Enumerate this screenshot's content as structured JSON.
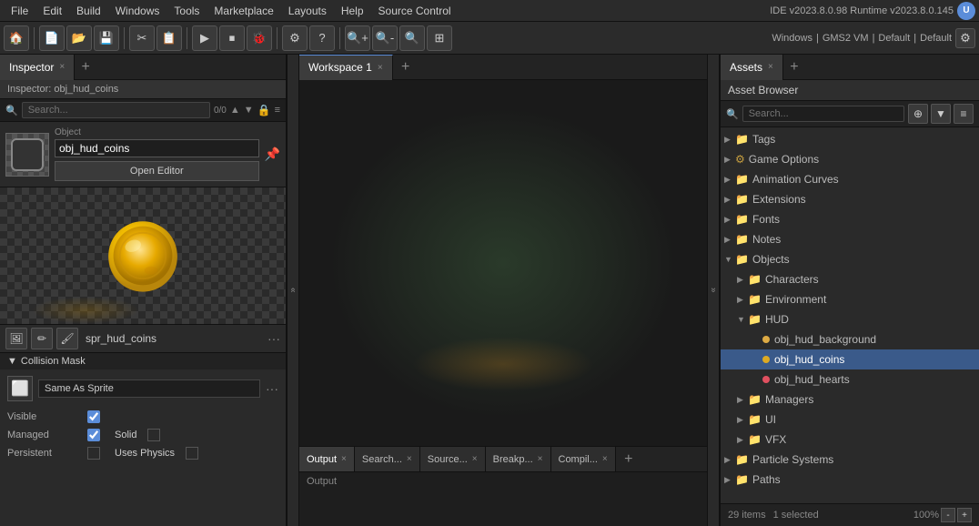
{
  "menubar": {
    "items": [
      "File",
      "Edit",
      "Build",
      "Windows",
      "Tools",
      "Marketplace",
      "Layouts",
      "Help",
      "Source Control"
    ],
    "version_info": "IDE v2023.8.0.98  Runtime v2023.8.0.145"
  },
  "toolbar": {
    "windows_label": "Windows",
    "gms2vm_label": "GMS2 VM",
    "default_labels": [
      "Default",
      "Default"
    ]
  },
  "inspector": {
    "tab_label": "Inspector",
    "header_text": "Inspector: obj_hud_coins",
    "search_placeholder": "Search...",
    "search_count": "0/0",
    "object_label": "Object",
    "object_name": "obj_hud_coins",
    "open_editor_label": "Open Editor"
  },
  "sprite": {
    "name": "spr_hud_coins"
  },
  "collision": {
    "section_label": "Collision Mask",
    "value": "Same As Sprite"
  },
  "properties": {
    "visible_label": "Visible",
    "managed_label": "Managed",
    "solid_label": "Solid",
    "persistent_label": "Persistent",
    "uses_physics_label": "Uses Physics"
  },
  "workspace": {
    "tab_label": "Workspace 1"
  },
  "output": {
    "tabs": [
      "Output",
      "Search...",
      "Source...",
      "Breakp...",
      "Compil..."
    ],
    "active_tab": "Output",
    "content_label": "Output"
  },
  "assets": {
    "tab_label": "Assets",
    "header_label": "Asset Browser",
    "search_placeholder": "Search...",
    "footer": {
      "count": "29 items",
      "selected": "1 selected",
      "zoom": "100%"
    },
    "tree": [
      {
        "id": "tags",
        "level": 1,
        "type": "folder",
        "label": "Tags",
        "arrow": "▶",
        "collapsed": true
      },
      {
        "id": "game-options",
        "level": 1,
        "type": "folder-gear",
        "label": "Game Options",
        "arrow": "▶",
        "collapsed": true
      },
      {
        "id": "animation-curves",
        "level": 1,
        "type": "folder",
        "label": "Animation Curves",
        "arrow": "▶",
        "collapsed": true
      },
      {
        "id": "extensions",
        "level": 1,
        "type": "folder",
        "label": "Extensions",
        "arrow": "▶",
        "collapsed": true
      },
      {
        "id": "fonts",
        "level": 1,
        "type": "folder",
        "label": "Fonts",
        "arrow": "▶",
        "collapsed": true
      },
      {
        "id": "notes",
        "level": 1,
        "type": "folder",
        "label": "Notes",
        "arrow": "▶",
        "collapsed": true
      },
      {
        "id": "objects",
        "level": 1,
        "type": "folder",
        "label": "Objects",
        "arrow": "▼",
        "collapsed": false
      },
      {
        "id": "characters",
        "level": 2,
        "type": "folder",
        "label": "Characters",
        "arrow": "▶",
        "collapsed": true
      },
      {
        "id": "environment",
        "level": 2,
        "type": "folder",
        "label": "Environment",
        "arrow": "▶",
        "collapsed": true
      },
      {
        "id": "hud",
        "level": 2,
        "type": "folder",
        "label": "HUD",
        "arrow": "▼",
        "collapsed": false
      },
      {
        "id": "obj-hud-background",
        "level": 3,
        "type": "file",
        "label": "obj_hud_background",
        "dot_color": "#ddaa44"
      },
      {
        "id": "obj-hud-coins",
        "level": 3,
        "type": "file",
        "label": "obj_hud_coins",
        "dot_color": "#ddaa22",
        "selected": true
      },
      {
        "id": "obj-hud-hearts",
        "level": 3,
        "type": "file",
        "label": "obj_hud_hearts",
        "dot_color": "#e05060"
      },
      {
        "id": "managers",
        "level": 2,
        "type": "folder",
        "label": "Managers",
        "arrow": "▶",
        "collapsed": true
      },
      {
        "id": "ui",
        "level": 2,
        "type": "folder",
        "label": "UI",
        "arrow": "▶",
        "collapsed": true
      },
      {
        "id": "vfx",
        "level": 2,
        "type": "folder",
        "label": "VFX",
        "arrow": "▶",
        "collapsed": true
      },
      {
        "id": "particle-systems",
        "level": 1,
        "type": "folder",
        "label": "Particle Systems",
        "arrow": "▶",
        "collapsed": true
      },
      {
        "id": "paths",
        "level": 1,
        "type": "folder",
        "label": "Paths",
        "arrow": "▶",
        "collapsed": true
      }
    ]
  },
  "icons": {
    "close": "×",
    "add": "+",
    "arrow_up": "▲",
    "arrow_down": "▼",
    "arrow_right": "▶",
    "lock": "🔒",
    "search": "🔍",
    "pin": "📌",
    "gear": "⚙",
    "filter": "▼",
    "menu": "≡",
    "plus_circle": "⊕",
    "chevron_left": "«",
    "chevron_right": "»"
  },
  "colors": {
    "accent_blue": "#5b8dd9",
    "selected_row": "#3a5a8a",
    "folder_yellow": "#c8a040",
    "dot_yellow": "#ddaa22",
    "dot_red": "#e05060",
    "dot_orange": "#ddaa44"
  }
}
